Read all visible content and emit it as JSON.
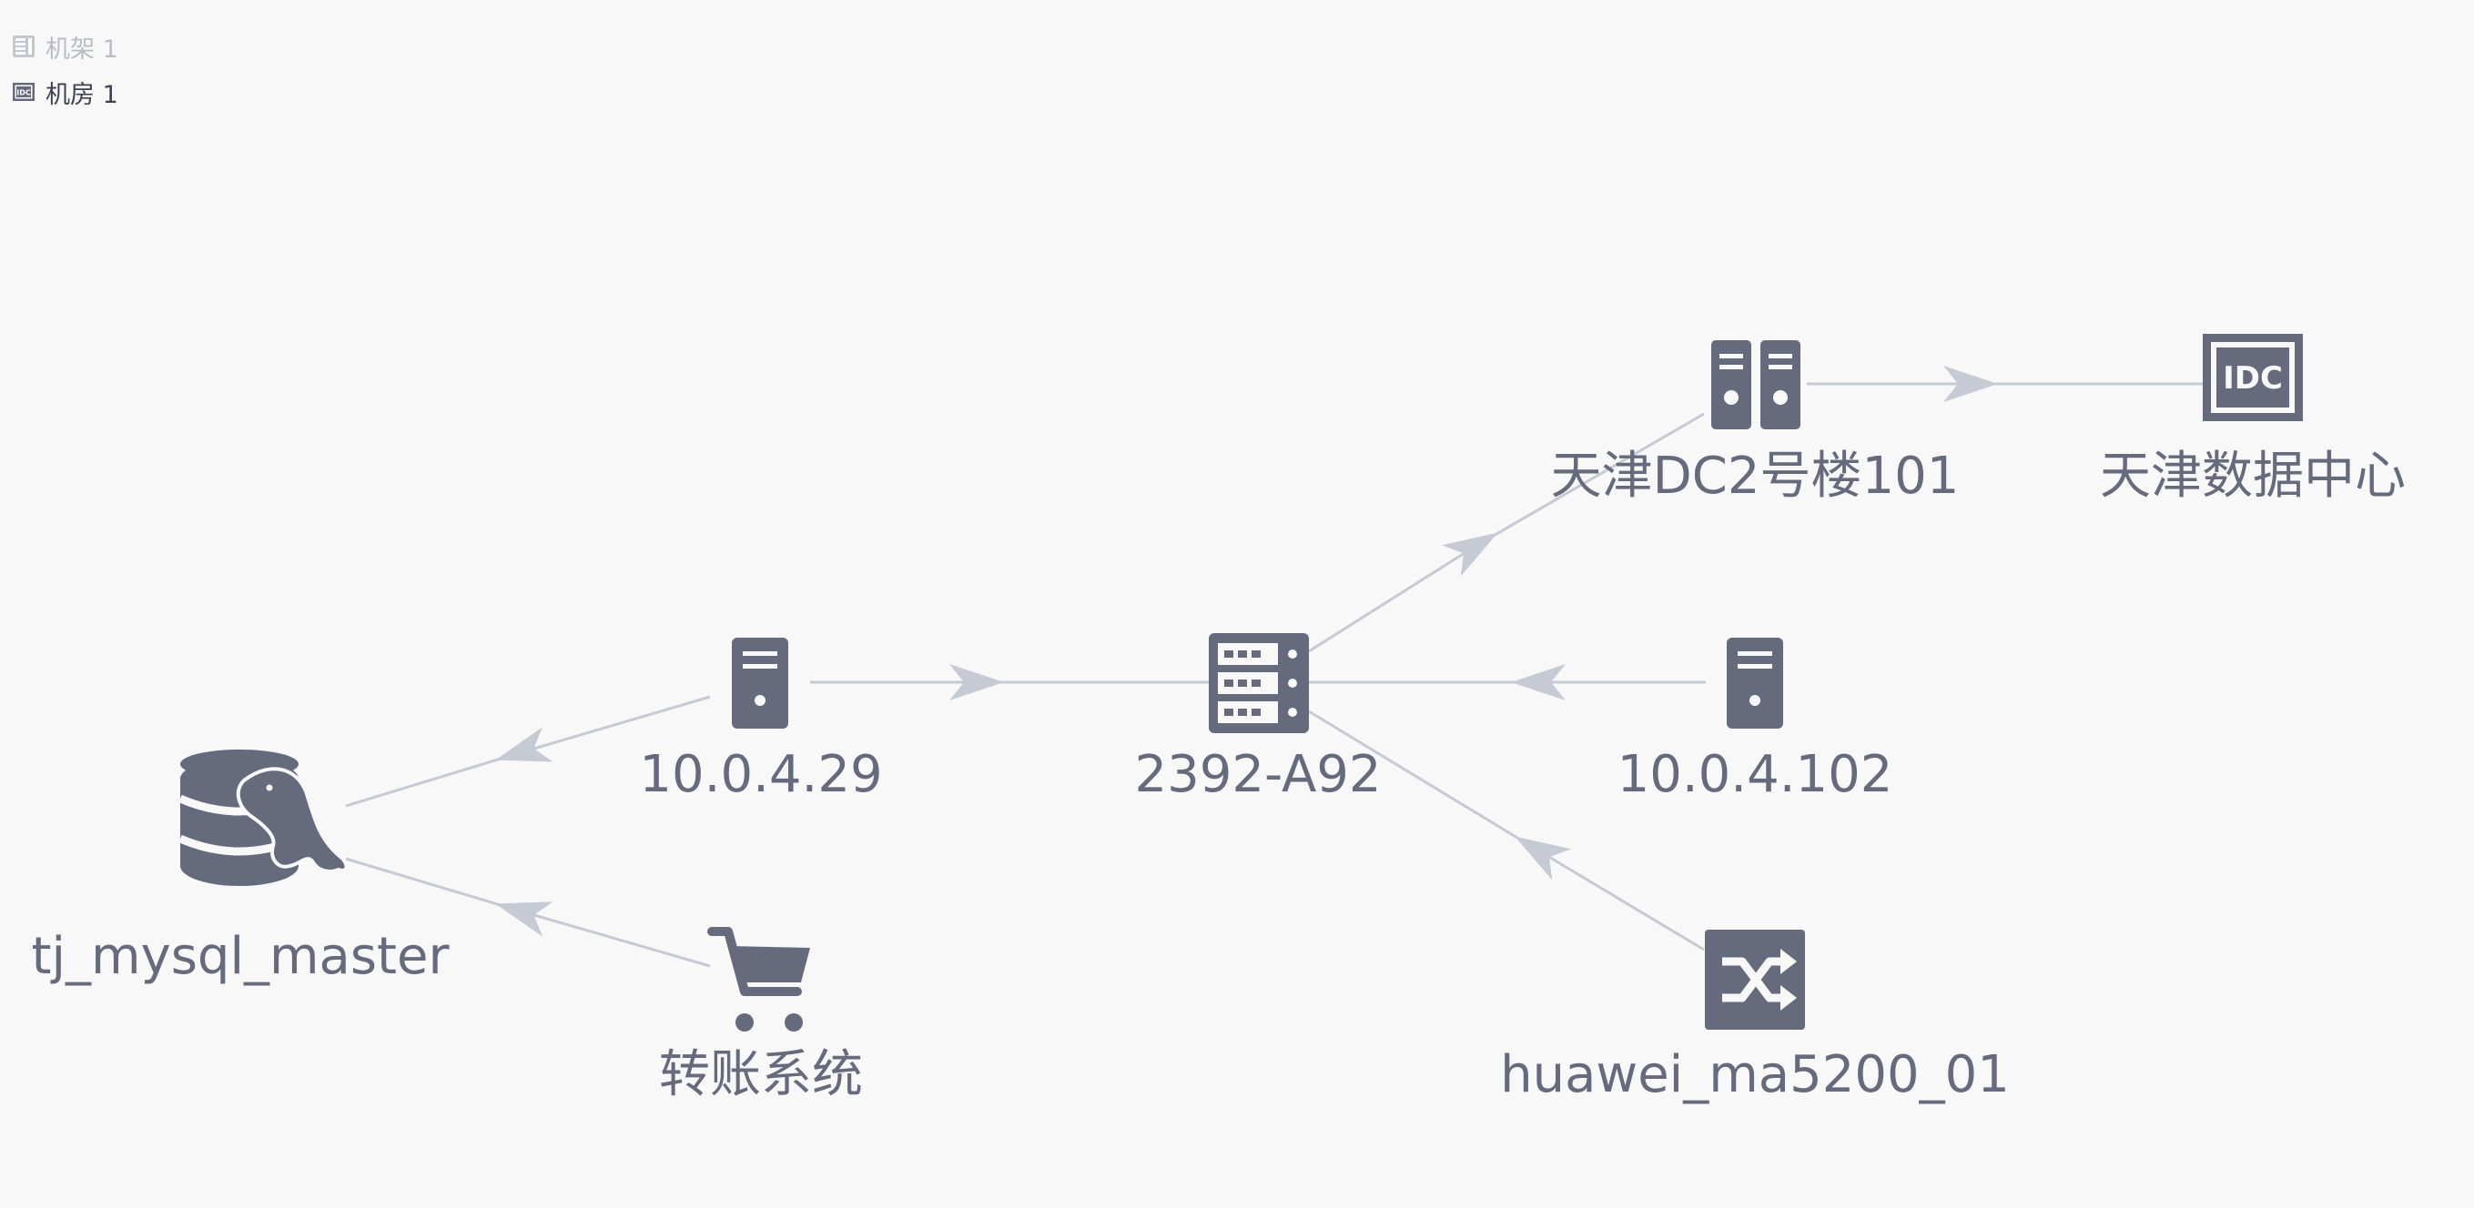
{
  "legend": {
    "items": [
      {
        "label": "机架 1",
        "icon": "rack-icon",
        "faded": true
      },
      {
        "label": "机房 1",
        "icon": "idc-icon",
        "faded": false
      }
    ]
  },
  "colors": {
    "node": "#656a7c",
    "edge": "#c5cad4",
    "background": "#f8f8f9"
  },
  "nodes": {
    "tj_mysql_master": {
      "label": "tj_mysql_master",
      "icon": "mysql-database-icon"
    },
    "ip_10_0_4_29": {
      "label": "10.0.4.29",
      "icon": "server-icon"
    },
    "transfer_system": {
      "label": "转账系统",
      "icon": "shopping-cart-icon"
    },
    "host_2392_a92": {
      "label": "2392-A92",
      "icon": "rack-server-icon"
    },
    "tianjin_dc2_101": {
      "label": "天津DC2号楼101",
      "icon": "machine-room-icon"
    },
    "tianjin_data_center": {
      "label": "天津数据中心",
      "icon": "idc-icon"
    },
    "ip_10_0_4_102": {
      "label": "10.0.4.102",
      "icon": "server-icon"
    },
    "huawei_ma5200_01": {
      "label": "huawei_ma5200_01",
      "icon": "switch-icon"
    }
  },
  "edges": [
    {
      "from": "ip_10_0_4_29",
      "to": "tj_mysql_master"
    },
    {
      "from": "transfer_system",
      "to": "tj_mysql_master"
    },
    {
      "from": "ip_10_0_4_29",
      "to": "host_2392_a92"
    },
    {
      "from": "host_2392_a92",
      "to": "tianjin_dc2_101"
    },
    {
      "from": "tianjin_dc2_101",
      "to": "tianjin_data_center"
    },
    {
      "from": "ip_10_0_4_102",
      "to": "host_2392_a92"
    },
    {
      "from": "huawei_ma5200_01",
      "to": "host_2392_a92"
    }
  ]
}
